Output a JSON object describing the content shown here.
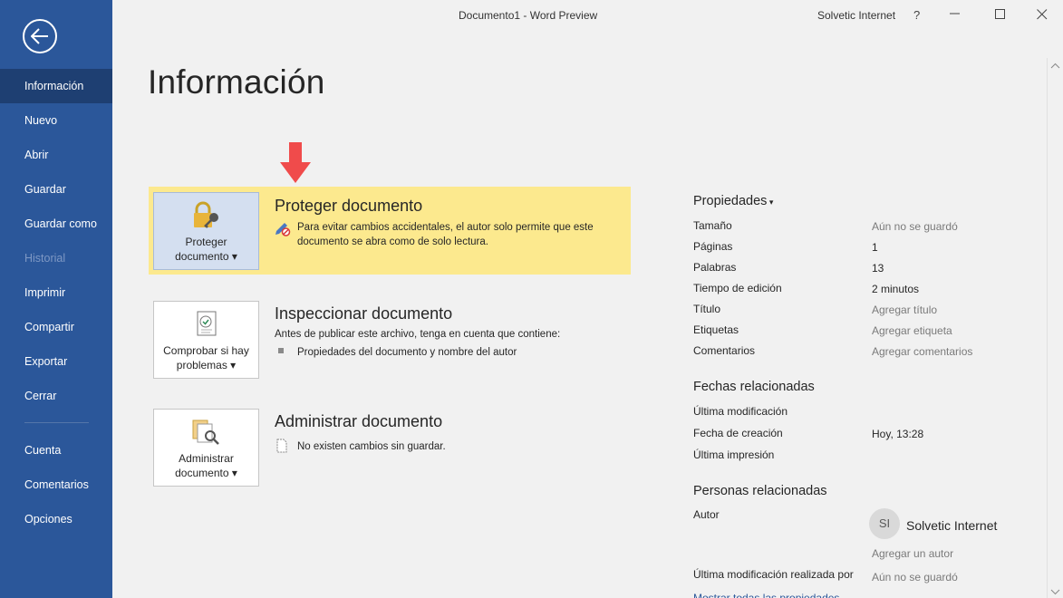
{
  "window": {
    "title": "Documento1  -  Word Preview",
    "account": "Solvetic Internet",
    "help": "?"
  },
  "sidebar": {
    "items": [
      {
        "label": "Información",
        "state": "active"
      },
      {
        "label": "Nuevo"
      },
      {
        "label": "Abrir"
      },
      {
        "label": "Guardar"
      },
      {
        "label": "Guardar como"
      },
      {
        "label": "Historial",
        "state": "disabled"
      },
      {
        "label": "Imprimir"
      },
      {
        "label": "Compartir"
      },
      {
        "label": "Exportar"
      },
      {
        "label": "Cerrar"
      },
      {
        "label": "Cuenta"
      },
      {
        "label": "Comentarios"
      },
      {
        "label": "Opciones"
      }
    ]
  },
  "page": {
    "heading": "Información"
  },
  "sections": {
    "protect": {
      "button_line1": "Proteger",
      "button_line2": "documento",
      "title": "Proteger documento",
      "desc_line1": "Para evitar cambios accidentales, el autor solo permite que este",
      "desc_line2": "documento se abra como de solo lectura.",
      "icon": "lock-key-icon"
    },
    "inspect": {
      "button_line1": "Comprobar si hay",
      "button_line2": "problemas",
      "title": "Inspeccionar documento",
      "intro": "Antes de publicar este archivo, tenga en cuenta que contiene:",
      "bullet": "Propiedades del documento y nombre del autor",
      "icon": "inspect-document-icon"
    },
    "manage": {
      "button_line1": "Administrar",
      "button_line2": "documento",
      "title": "Administrar documento",
      "status": "No existen cambios sin guardar.",
      "icon": "manage-document-icon"
    }
  },
  "properties": {
    "heading": "Propiedades",
    "rows": [
      {
        "label": "Tamaño",
        "value": "Aún no se guardó",
        "muted": true
      },
      {
        "label": "Páginas",
        "value": "1"
      },
      {
        "label": "Palabras",
        "value": "13"
      },
      {
        "label": "Tiempo de edición",
        "value": "2 minutos"
      },
      {
        "label": "Título",
        "value": "Agregar título",
        "muted": true
      },
      {
        "label": "Etiquetas",
        "value": "Agregar etiqueta",
        "muted": true
      },
      {
        "label": "Comentarios",
        "value": "Agregar comentarios",
        "muted": true
      }
    ],
    "dates_heading": "Fechas relacionadas",
    "dates": [
      {
        "label": "Última modificación",
        "value": ""
      },
      {
        "label": "Fecha de creación",
        "value": "Hoy, 13:28"
      },
      {
        "label": "Última impresión",
        "value": ""
      }
    ],
    "people_heading": "Personas relacionadas",
    "author_label": "Autor",
    "author_initials": "SI",
    "author_name": "Solvetic Internet",
    "add_author": "Agregar un autor",
    "last_modified_by_label": "Última modificación realizada por",
    "last_modified_by_value": "Aún no se guardó",
    "show_all_link": "Mostrar todas las propiedades"
  },
  "colors": {
    "sidebar": "#2b579a",
    "sidebar_active": "#1e3f72",
    "highlight": "#fce98e",
    "arrow": "#f04b4b"
  }
}
